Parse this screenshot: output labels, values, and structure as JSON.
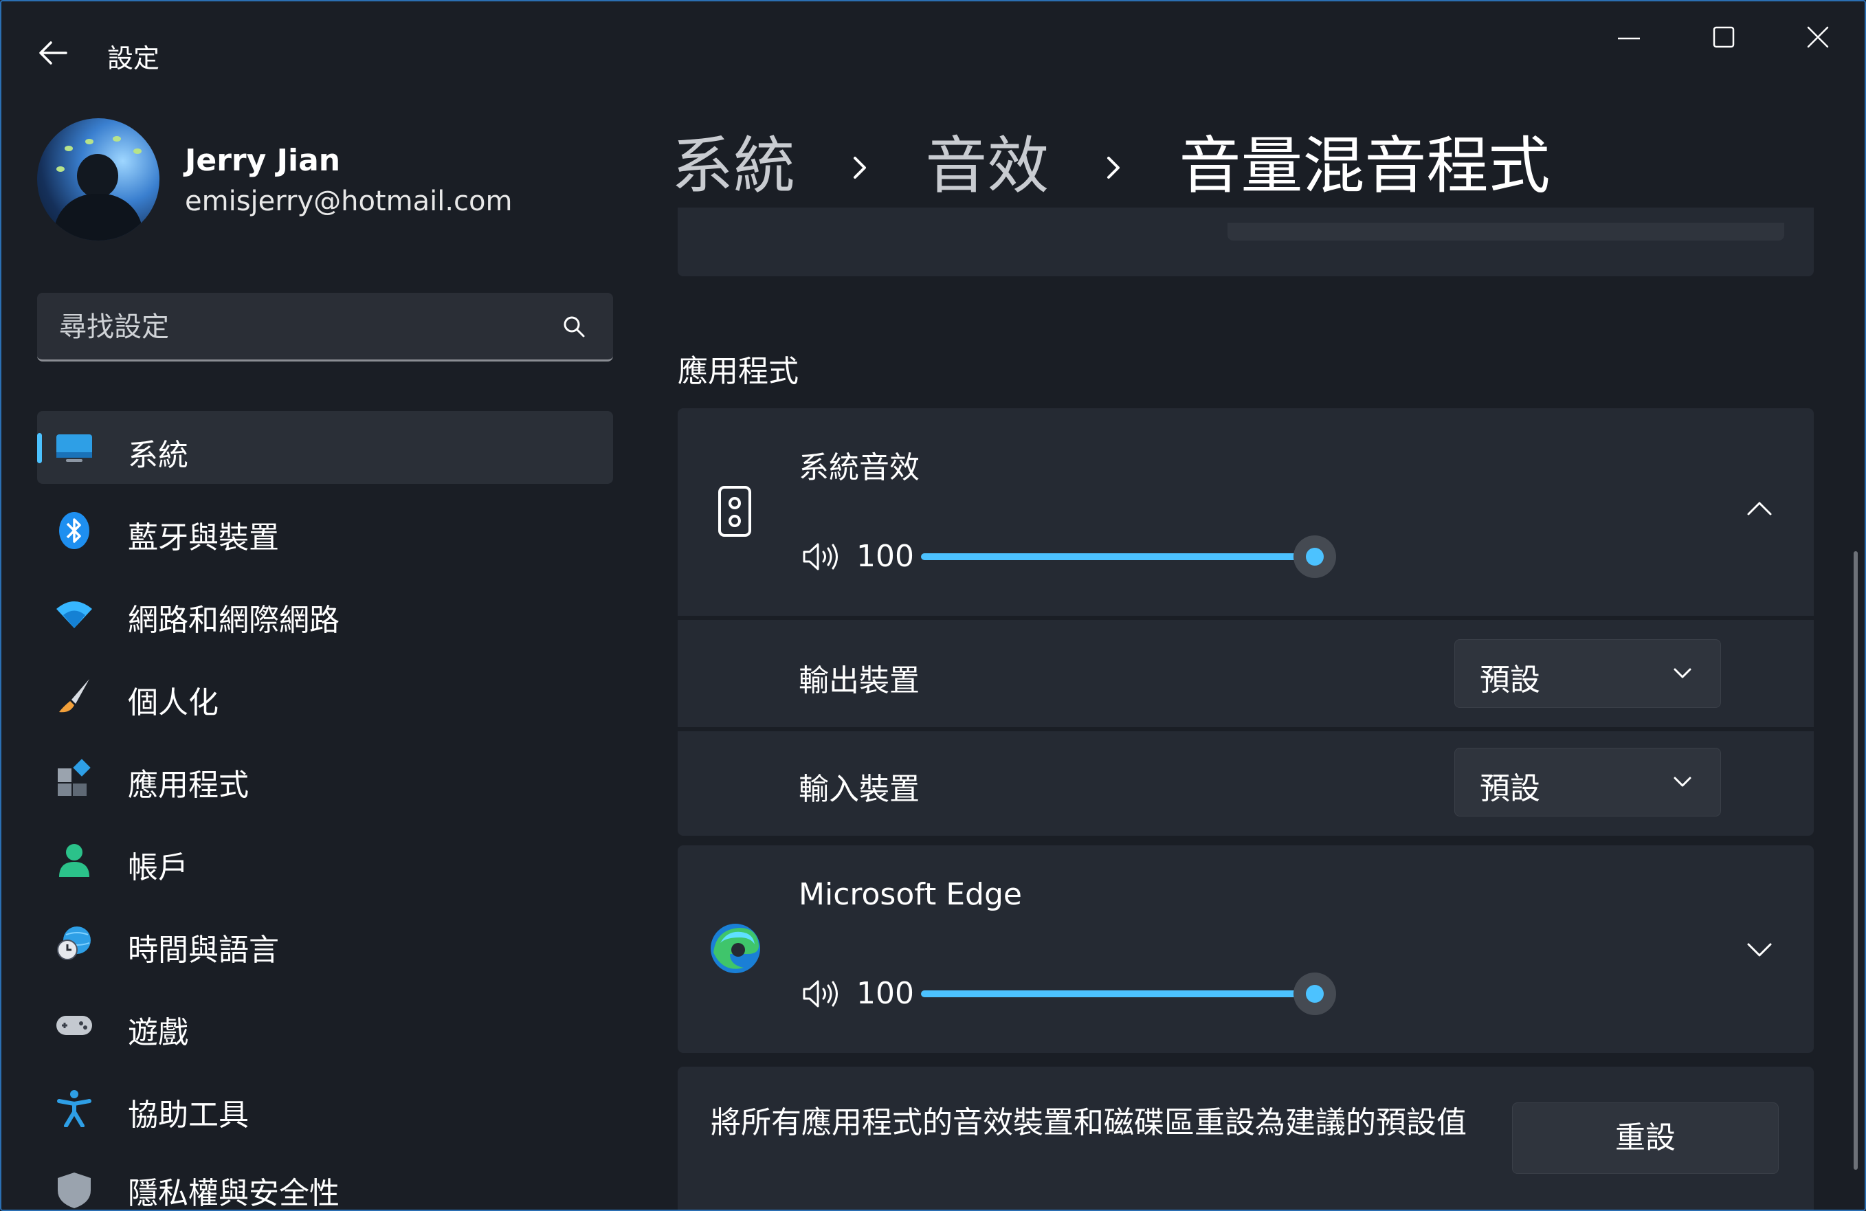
{
  "window": {
    "title": "設定",
    "accent_color": "#4cc2ff",
    "controls": [
      "minimize-icon",
      "maximize-icon",
      "close-icon"
    ]
  },
  "profile": {
    "name": "Jerry Jian",
    "email": "emisjerry@hotmail.com"
  },
  "search": {
    "placeholder": "尋找設定"
  },
  "sidebar": {
    "items": [
      {
        "label": "系統",
        "icon": "system-icon",
        "selected": true
      },
      {
        "label": "藍牙與裝置",
        "icon": "bluetooth-icon"
      },
      {
        "label": "網路和網際網路",
        "icon": "wifi-icon"
      },
      {
        "label": "個人化",
        "icon": "brush-icon"
      },
      {
        "label": "應用程式",
        "icon": "apps-icon"
      },
      {
        "label": "帳戶",
        "icon": "account-icon"
      },
      {
        "label": "時間與語言",
        "icon": "time-language-icon"
      },
      {
        "label": "遊戲",
        "icon": "gaming-icon"
      },
      {
        "label": "協助工具",
        "icon": "accessibility-icon"
      },
      {
        "label": "隱私權與安全性",
        "icon": "privacy-shield-icon"
      }
    ]
  },
  "breadcrumb": {
    "items": [
      "系統",
      "音效",
      "音量混音程式"
    ]
  },
  "apps_section": {
    "title": "應用程式",
    "system_sounds": {
      "name": "系統音效",
      "volume": "100",
      "volume_level": 1.0,
      "expanded": true,
      "output_label": "輸出裝置",
      "output_value": "預設",
      "input_label": "輸入裝置",
      "input_value": "預設"
    },
    "edge": {
      "name": "Microsoft Edge",
      "volume": "100",
      "volume_level": 1.0,
      "expanded": false
    }
  },
  "reset": {
    "description": "將所有應用程式的音效裝置和磁碟區重設為建議的預設值",
    "button_label": "重設"
  }
}
